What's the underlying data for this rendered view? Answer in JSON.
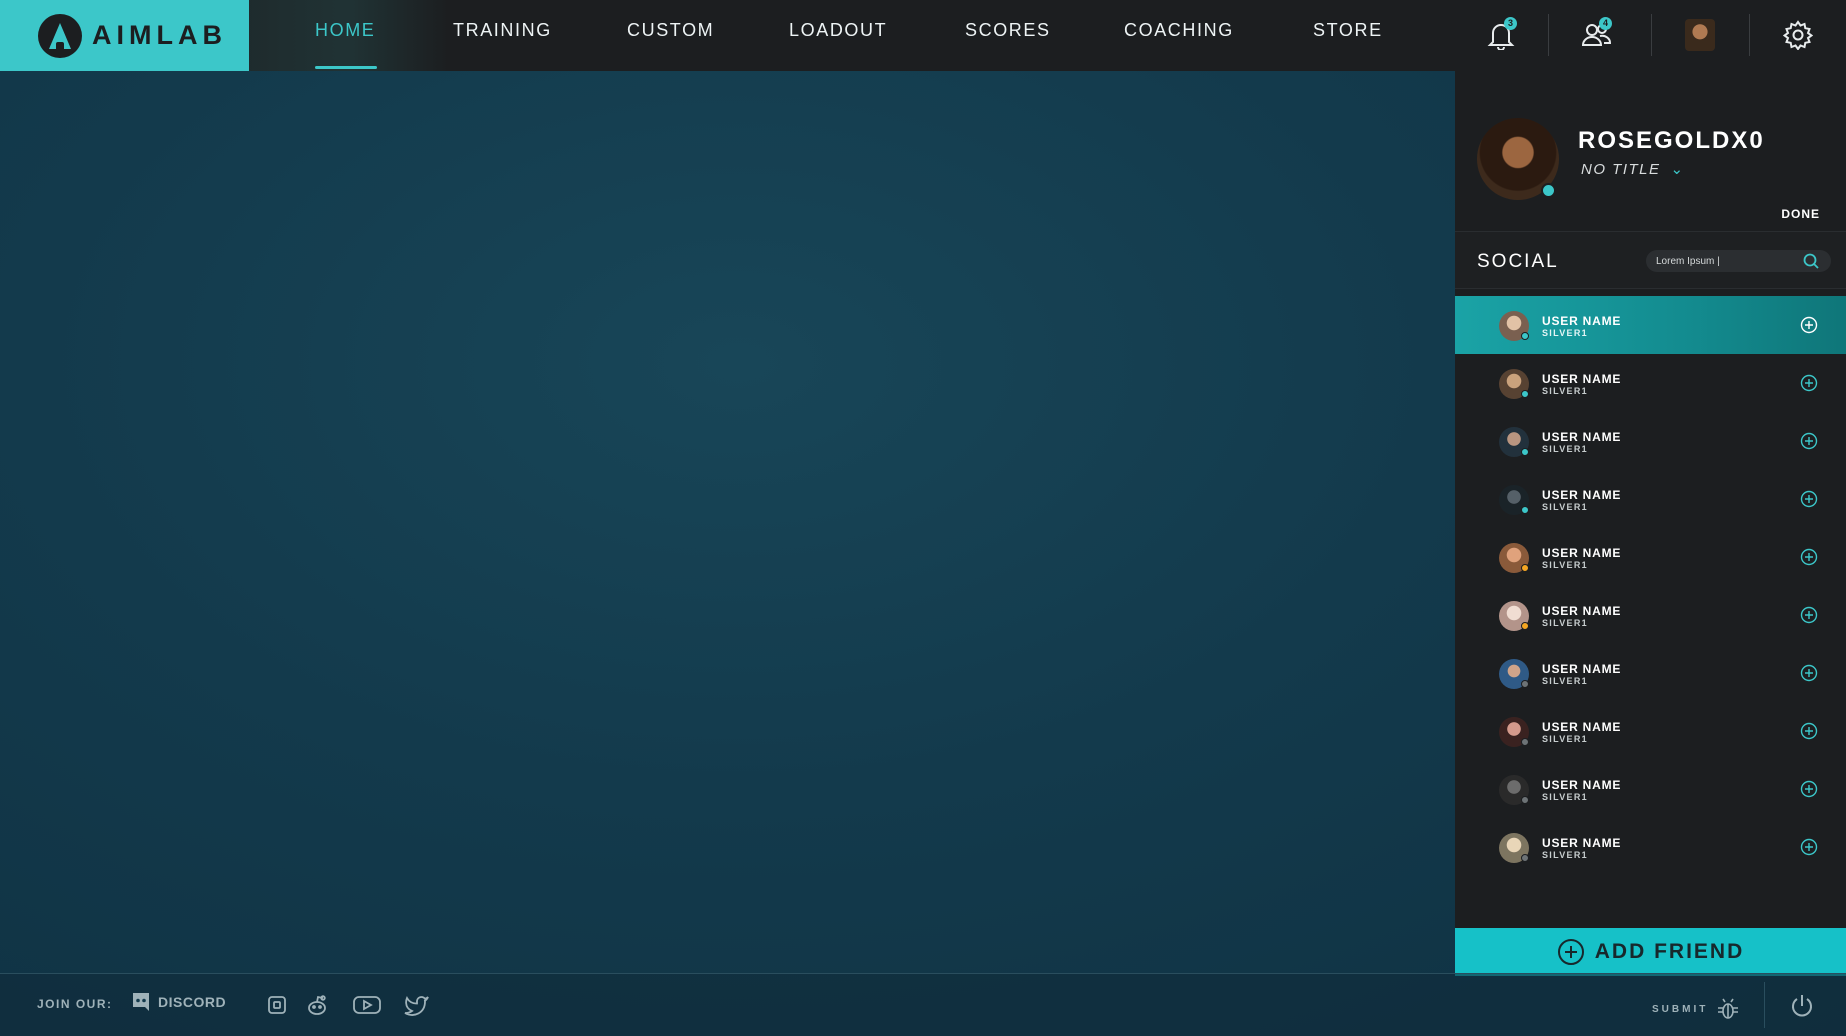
{
  "app": {
    "brand": "AIMLAB"
  },
  "nav": {
    "items": [
      {
        "label": "HOME",
        "active": true
      },
      {
        "label": "TRAINING"
      },
      {
        "label": "CUSTOM"
      },
      {
        "label": "LOADOUT"
      },
      {
        "label": "SCORES"
      },
      {
        "label": "COACHING"
      },
      {
        "label": "STORE"
      }
    ]
  },
  "header_icons": {
    "notifications": {
      "icon": "bell-icon",
      "count": "3"
    },
    "friends": {
      "icon": "friends-icon",
      "count": "4"
    },
    "profile": {
      "icon": "avatar"
    },
    "settings": {
      "icon": "gear-icon"
    }
  },
  "profile": {
    "username": "ROSEGOLDX0",
    "title": "NO TITLE",
    "status": "online",
    "done_label": "DONE"
  },
  "social": {
    "title": "SOCIAL",
    "search_value": "Lorem Ipsum |",
    "friends": [
      {
        "name": "USER NAME",
        "rank": "SILVER1",
        "status": "online",
        "status_color": "#3cc7c9",
        "selected": true
      },
      {
        "name": "USER NAME",
        "rank": "SILVER1",
        "status": "online",
        "status_color": "#3cc7c9"
      },
      {
        "name": "USER NAME",
        "rank": "SILVER1",
        "status": "online",
        "status_color": "#3cc7c9"
      },
      {
        "name": "USER NAME",
        "rank": "SILVER1",
        "status": "online",
        "status_color": "#3cc7c9"
      },
      {
        "name": "USER NAME",
        "rank": "SILVER1",
        "status": "away",
        "status_color": "#f5a623"
      },
      {
        "name": "USER NAME",
        "rank": "SILVER1",
        "status": "away",
        "status_color": "#f5a623"
      },
      {
        "name": "USER NAME",
        "rank": "SILVER1",
        "status": "offline",
        "status_color": "#6d7376"
      },
      {
        "name": "USER NAME",
        "rank": "SILVER1",
        "status": "offline",
        "status_color": "#6d7376"
      },
      {
        "name": "USER NAME",
        "rank": "SILVER1",
        "status": "offline",
        "status_color": "#6d7376"
      },
      {
        "name": "USER NAME",
        "rank": "SILVER1",
        "status": "offline",
        "status_color": "#6d7376"
      }
    ],
    "add_friend_label": "ADD FRIEND"
  },
  "footer": {
    "join_label": "JOIN OUR:",
    "discord_label": "DISCORD",
    "links": [
      "instagram-icon",
      "reddit-icon",
      "youtube-icon",
      "twitter-icon"
    ],
    "submit_label": "SUBMIT",
    "submit_icon": "bug-icon",
    "power_icon": "power-icon"
  },
  "colors": {
    "accent": "#3cc7c9",
    "panel": "#1c1e20",
    "background": "#13384a"
  }
}
